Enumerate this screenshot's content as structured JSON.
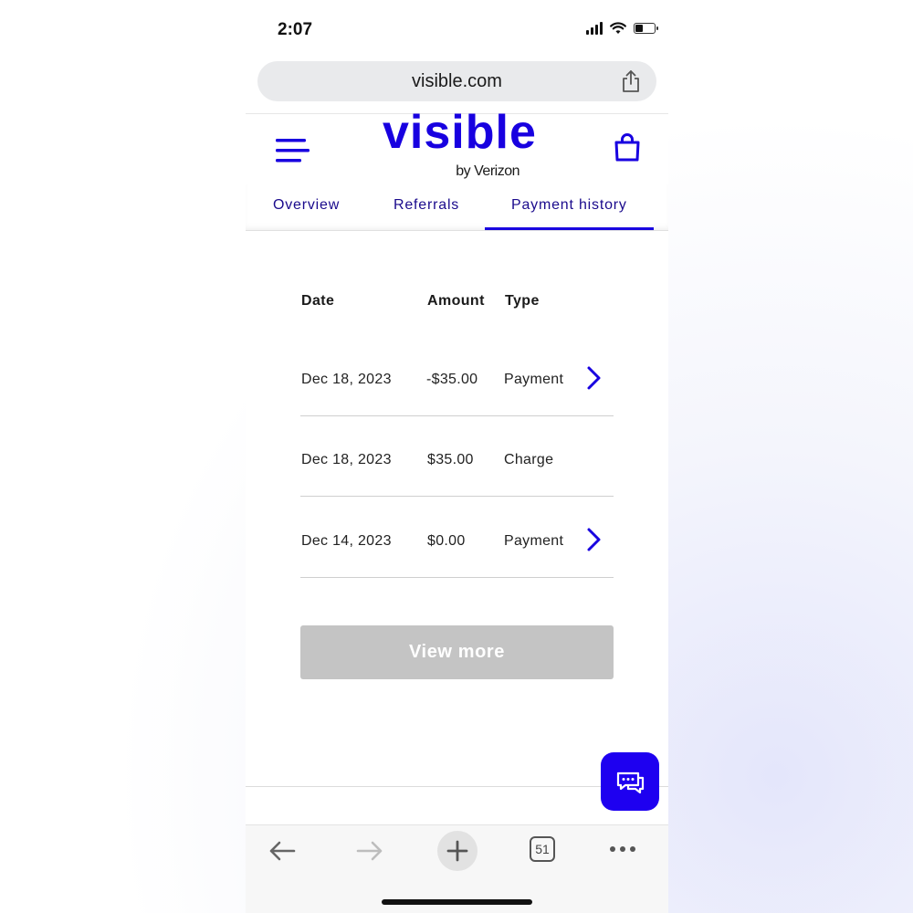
{
  "status_bar": {
    "time": "2:07",
    "battery_level": 0.4
  },
  "browser": {
    "url": "visible.com"
  },
  "header": {
    "logo_text": "visible",
    "logo_sub": "by Verizon"
  },
  "tabs": [
    {
      "label": "Overview",
      "active": false
    },
    {
      "label": "Referrals",
      "active": false
    },
    {
      "label": "Payment history",
      "active": true
    }
  ],
  "table": {
    "headers": {
      "date": "Date",
      "amount": "Amount",
      "type": "Type"
    },
    "rows": [
      {
        "date": "Dec 18, 2023",
        "amount": "-$35.00",
        "type": "Payment",
        "has_detail": true
      },
      {
        "date": "Dec 18, 2023",
        "amount": "$35.00",
        "type": "Charge",
        "has_detail": false
      },
      {
        "date": "Dec 14, 2023",
        "amount": "$0.00",
        "type": "Payment",
        "has_detail": true
      }
    ]
  },
  "view_more_label": "View more",
  "toolbar": {
    "tab_count": "51"
  },
  "colors": {
    "brand": "#1800e0",
    "chat_button": "#1e00f0",
    "disabled_button": "#c4c4c4"
  }
}
